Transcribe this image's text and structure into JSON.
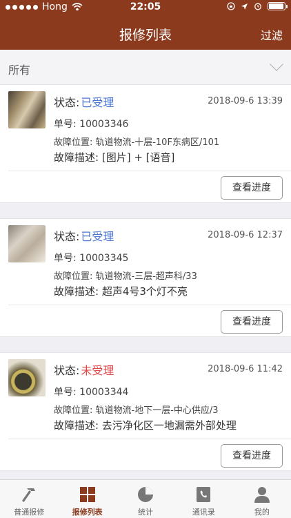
{
  "statusbar": {
    "carrier": "Hong",
    "time": "22:05"
  },
  "nav": {
    "title": "报修列表",
    "filter_label": "过滤"
  },
  "filter": {
    "selected": "所有"
  },
  "labels": {
    "status": "状态:",
    "order": "单号:",
    "location": "故障位置:",
    "desc": "故障描述:",
    "progress_button": "查看进度"
  },
  "cards": [
    {
      "status": "已受理",
      "status_color": "#4a77d4",
      "date": "2018-09-6 13:39",
      "order_no": "10003346",
      "location": "轨道物流-十层-10F东病区/101",
      "desc": "[图片] + [语音]"
    },
    {
      "status": "已受理",
      "status_color": "#4a77d4",
      "date": "2018-09-6 12:37",
      "order_no": "10003345",
      "location": "轨道物流-三层-超声科/33",
      "desc": "超声4号3个灯不亮"
    },
    {
      "status": "未受理",
      "status_color": "#e04848",
      "date": "2018-09-6 11:42",
      "order_no": "10003344",
      "location": "轨道物流-地下一层-中心供应/3",
      "desc": "去污净化区一地漏需外部处理"
    }
  ],
  "tabs": [
    {
      "label": "普通报修",
      "icon": "hammer-icon"
    },
    {
      "label": "报修列表",
      "icon": "grid-icon",
      "active": true
    },
    {
      "label": "统计",
      "icon": "pie-chart-icon"
    },
    {
      "label": "通讯录",
      "icon": "contacts-icon"
    },
    {
      "label": "我的",
      "icon": "user-icon"
    }
  ],
  "colors": {
    "brand": "#8b3a1e",
    "accepted": "#4a77d4",
    "not_accepted": "#e04848"
  }
}
